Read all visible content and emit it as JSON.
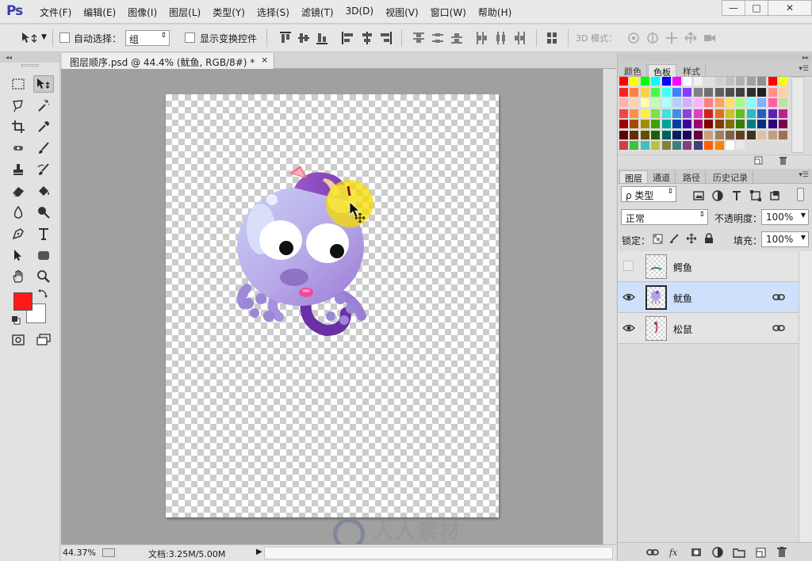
{
  "app": {
    "logo": "Ps"
  },
  "menu": [
    "文件(F)",
    "编辑(E)",
    "图像(I)",
    "图层(L)",
    "类型(Y)",
    "选择(S)",
    "滤镜(T)",
    "3D(D)",
    "视图(V)",
    "窗口(W)",
    "帮助(H)"
  ],
  "window_controls": {
    "minimize": "—",
    "maximize": "□",
    "close": "✕"
  },
  "options": {
    "auto_select_label": "自动选择：",
    "auto_select_value": "组",
    "show_transform_label": "显示变换控件",
    "mode_3d_label": "3D 模式："
  },
  "document": {
    "tab_title": "图层顺序.psd @ 44.4% (鱿鱼, RGB/8#) *",
    "tab_close": "×"
  },
  "status": {
    "zoom": "44.37%",
    "doc_info": "文档:3.25M/5.00M",
    "arrow": "▶"
  },
  "watermark": "人人素材",
  "colors": {
    "foreground": "#ff1a1a",
    "background": "#ffffff",
    "selection": "#cfe0fa"
  },
  "swatch_panel": {
    "tabs": [
      "颜色",
      "色板",
      "样式"
    ],
    "active_tab": "色板",
    "swatch_rows": [
      [
        "#ff0000",
        "#ffff00",
        "#00ff00",
        "#00ffff",
        "#0000ff",
        "#ff00ff",
        "#ffffff",
        "#f0f0f0",
        "#e0e0e0",
        "#d0d0d0",
        "#c0c0c0",
        "#b0b0b0",
        "#a0a0a0",
        "#909090",
        "#ff0000",
        "#ffff00"
      ],
      [
        "#ff2020",
        "#ff8040",
        "#ffd040",
        "#40ff40",
        "#40ffff",
        "#4080ff",
        "#8040ff",
        "#808080",
        "#707070",
        "#606060",
        "#505050",
        "#404040",
        "#303030",
        "#202020",
        "#ff9090",
        "#ffd0a0"
      ],
      [
        "#ffb0b0",
        "#ffd0b0",
        "#ffffb0",
        "#c0ffb0",
        "#b0ffff",
        "#b0d0ff",
        "#d0b0ff",
        "#ffb0ff",
        "#ff8080",
        "#ffa060",
        "#ffe060",
        "#a0ff80",
        "#80ffff",
        "#80b0ff",
        "#ff60a0",
        "#c0e0a0"
      ],
      [
        "#ff4040",
        "#ff9040",
        "#ffee40",
        "#80e040",
        "#40e0e0",
        "#4090e0",
        "#9040e0",
        "#e040c0",
        "#d02020",
        "#e07020",
        "#d0c020",
        "#60c020",
        "#20c0c0",
        "#2060c0",
        "#6020c0",
        "#c02090"
      ],
      [
        "#a00000",
        "#a05000",
        "#a09000",
        "#40a000",
        "#00a0a0",
        "#0040a0",
        "#4000a0",
        "#a00070",
        "#800000",
        "#804000",
        "#807000",
        "#308000",
        "#008080",
        "#003080",
        "#300080",
        "#800050"
      ],
      [
        "#600000",
        "#603000",
        "#605000",
        "#206000",
        "#006060",
        "#002060",
        "#200060",
        "#600040",
        "#c8a080",
        "#a08060",
        "#806040",
        "#604020",
        "#403020",
        "#e0c0a0",
        "#c0a080",
        "#a07050"
      ],
      [
        "#d04040",
        "#40c040",
        "#40c0c0",
        "#c0c040",
        "#808040",
        "#408080",
        "#804080",
        "#404080",
        "#ff6000",
        "#ff8000",
        "#ffffff",
        "#e8e8e8"
      ]
    ]
  },
  "layers_panel": {
    "tabs": [
      "图层",
      "通道",
      "路径",
      "历史记录"
    ],
    "active_tab": "图层",
    "filter_label": "ρ 类型",
    "blend_mode": "正常",
    "opacity_label": "不透明度：",
    "opacity_value": "100%",
    "lock_label": "锁定：",
    "fill_label": "填充：",
    "fill_value": "100%",
    "layers": [
      {
        "name": "鳄鱼",
        "visible": false,
        "selected": false,
        "linked": false
      },
      {
        "name": "鱿鱼",
        "visible": true,
        "selected": true,
        "linked": true
      },
      {
        "name": "松鼠",
        "visible": true,
        "selected": false,
        "linked": true
      }
    ]
  },
  "icons": {
    "move": "move-tool-icon",
    "marquee": "rect-marquee-icon",
    "lasso": "lasso-icon",
    "wand": "magic-wand-icon",
    "crop": "crop-icon",
    "eyedropper": "eyedropper-icon",
    "heal": "healing-brush-icon",
    "brush": "brush-icon",
    "stamp": "clone-stamp-icon",
    "history": "history-brush-icon",
    "eraser": "eraser-icon",
    "bucket": "paint-bucket-icon",
    "blur": "blur-icon",
    "dodge": "dodge-icon",
    "pen": "pen-icon",
    "type": "type-icon",
    "select": "path-select-icon",
    "shape": "shape-icon",
    "hand": "hand-icon",
    "zoom": "zoom-icon"
  }
}
